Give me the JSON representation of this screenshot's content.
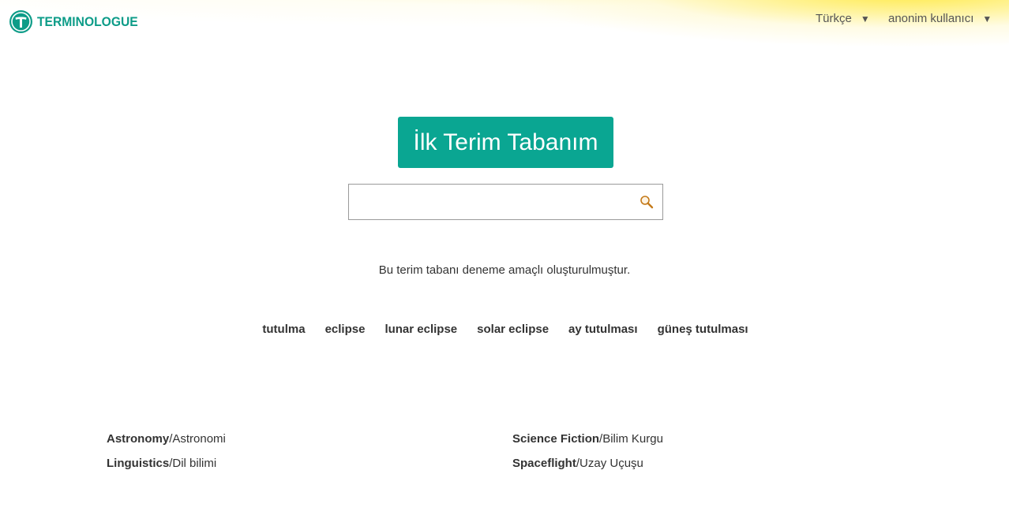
{
  "header": {
    "logo_text": "TERMINOLOGUE",
    "language_menu": "Türkçe",
    "user_menu": "anonim kullanıcı"
  },
  "main": {
    "termbase_button": "İlk Terim Tabanım",
    "search": {
      "value": "",
      "placeholder": ""
    },
    "intro_text": "Bu terim tabanı deneme amaçlı oluşturulmuştur.",
    "terms": [
      "tutulma",
      "eclipse",
      "lunar eclipse",
      "solar eclipse",
      "ay tutulması",
      "güneş tutulması"
    ]
  },
  "domains": {
    "left": [
      {
        "name": "Astronomy",
        "translation": "/Astronomi"
      },
      {
        "name": "Linguistics",
        "translation": "/Dil bilimi"
      }
    ],
    "right": [
      {
        "name": "Science Fiction",
        "translation": "/Bilim Kurgu"
      },
      {
        "name": "Spaceflight",
        "translation": "/Uzay Uçuşu"
      }
    ]
  },
  "colors": {
    "brand": "#0d9c88",
    "button": "#0aa692",
    "glow": "#ffe83c",
    "search_icon": "#c47a1a"
  },
  "icons": {
    "logo": "terminologue-t-logo-icon",
    "caret": "triangle-down-icon",
    "search": "magnifier-icon"
  }
}
